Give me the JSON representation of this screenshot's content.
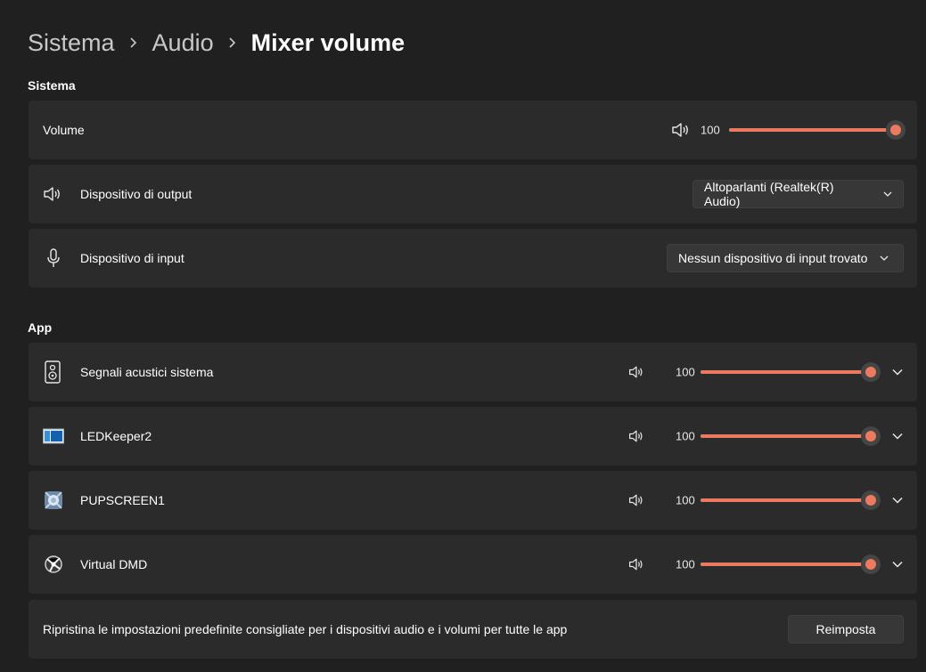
{
  "breadcrumb": {
    "items": [
      "Sistema",
      "Audio"
    ],
    "current": "Mixer volume"
  },
  "system_section": {
    "title": "Sistema",
    "volume": {
      "label": "Volume",
      "value": "100",
      "level_percent": 100
    },
    "output": {
      "label": "Dispositivo di output",
      "selected": "Altoparlanti (Realtek(R) Audio)"
    },
    "input": {
      "label": "Dispositivo di input",
      "selected": "Nessun dispositivo di input trovato"
    }
  },
  "app_section": {
    "title": "App",
    "apps": [
      {
        "name": "Segnali acustici sistema",
        "value": "100",
        "level_percent": 100,
        "icon": "speaker-device-icon"
      },
      {
        "name": "LEDKeeper2",
        "value": "100",
        "level_percent": 100,
        "icon": "ledkeeper-app-icon"
      },
      {
        "name": "PUPSCREEN1",
        "value": "100",
        "level_percent": 100,
        "icon": "pupscreen-app-icon"
      },
      {
        "name": "Virtual DMD",
        "value": "100",
        "level_percent": 100,
        "icon": "virtual-dmd-app-icon"
      }
    ]
  },
  "reset": {
    "label": "Ripristina le impostazioni predefinite consigliate per i dispositivi audio e i volumi per tutte le app",
    "button": "Reimposta"
  },
  "colors": {
    "accent": "#ec7a5e",
    "background": "#202020",
    "card": "#2b2b2b"
  }
}
